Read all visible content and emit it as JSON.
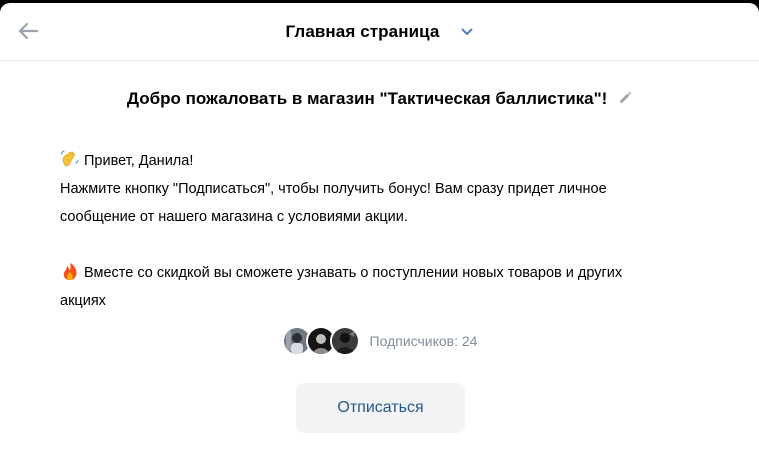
{
  "header": {
    "title": "Главная страница",
    "back_icon": "arrow-left-icon",
    "dropdown_icon": "chevron-down-icon"
  },
  "welcome": {
    "text": "Добро пожаловать в магазин \"Тактическая баллистика\"!",
    "edit_icon": "pencil-icon"
  },
  "message": {
    "greeting_icon": "waving-hand-emoji",
    "greeting": "Привет, Данила!",
    "line1": "Нажмите кнопку \"Подписаться\", чтобы получить бонус! Вам сразу придет личное",
    "line2": "сообщение от нашего магазина с условиями акции.",
    "fire_icon": "fire-emoji",
    "line3": "Вместе со скидкой вы сможете узнавать о поступлении новых товаров и других",
    "line4": "акциях"
  },
  "subscribers": {
    "label": "Подписчиков: 24",
    "avatar_count": 3
  },
  "unsubscribe_button": {
    "label": "Отписаться"
  },
  "colors": {
    "accent": "#2a5885",
    "muted_text": "#818c99",
    "button_bg": "#f2f3f5",
    "icon_blue": "#5181b8"
  }
}
